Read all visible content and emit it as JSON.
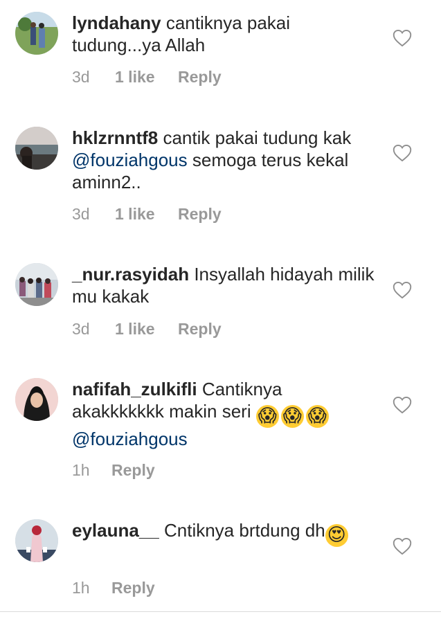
{
  "comments": [
    {
      "username": "lyndahany",
      "text": "cantiknya pakai tudung...ya Allah",
      "time": "3d",
      "likes": "1 like",
      "reply": "Reply"
    },
    {
      "username": "hklzrnntf8",
      "text_before": "cantik pakai tudung kak",
      "mention": "@fouziahgous",
      "text_after": "semoga terus kekal aminn2..",
      "time": "3d",
      "likes": "1 like",
      "reply": "Reply"
    },
    {
      "username": "_nur.rasyidah",
      "text": "Insyallah hidayah milik mu kakak",
      "time": "3d",
      "likes": "1 like",
      "reply": "Reply"
    },
    {
      "username": "nafifah_zulkifli",
      "text": "Cantiknya akakkkkkkk makin seri",
      "emojis": [
        "😱",
        "😱",
        "😱"
      ],
      "mention": "@fouziahgous",
      "time": "1h",
      "reply": "Reply"
    },
    {
      "username": "eylauna__",
      "text": "Cntiknya brtdung dh",
      "emoji": "😍",
      "time": "1h",
      "reply": "Reply"
    }
  ],
  "icons": {
    "like": "heart-outline-icon"
  },
  "colors": {
    "text": "#262626",
    "meta": "#999999",
    "mention": "#003569"
  }
}
